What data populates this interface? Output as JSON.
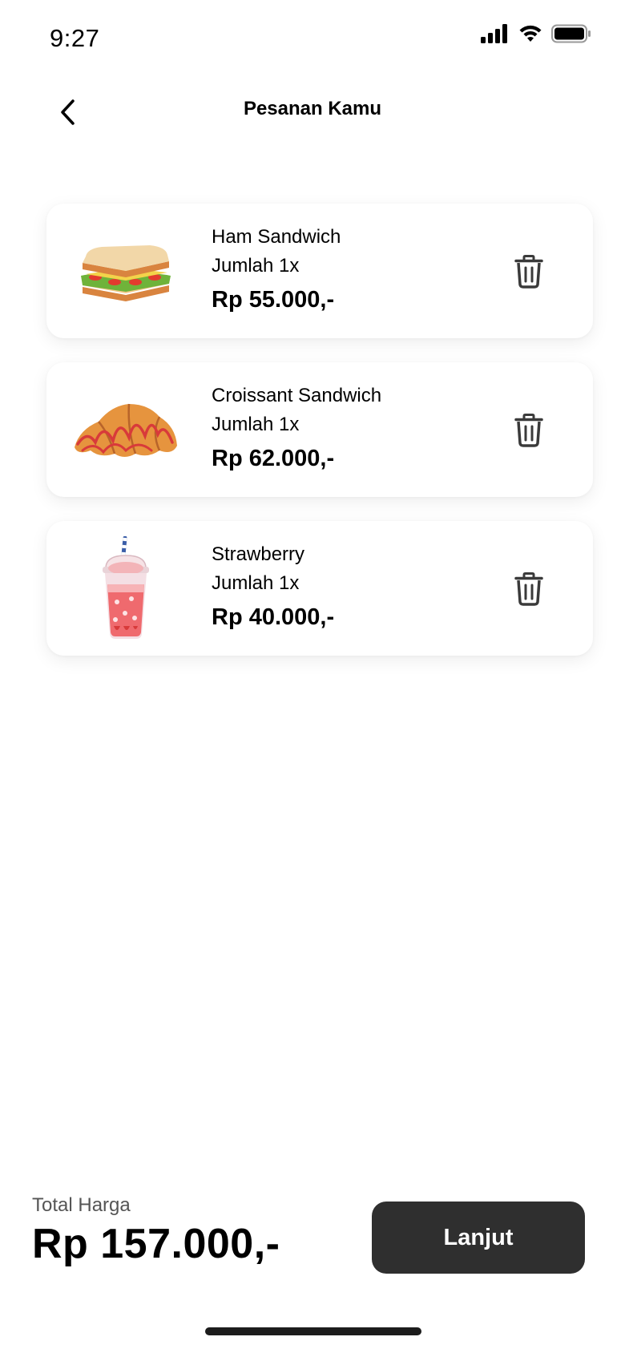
{
  "status_bar": {
    "time": "9:27",
    "icons": [
      "signal-icon",
      "wifi-icon",
      "battery-icon"
    ]
  },
  "header": {
    "back_icon": "chevron-left-icon",
    "title": "Pesanan Kamu"
  },
  "orders": [
    {
      "name": "Ham Sandwich",
      "quantity": "Jumlah 1x",
      "price": "Rp 55.000,-",
      "image": "ham-sandwich-image"
    },
    {
      "name": "Croissant Sandwich",
      "quantity": "Jumlah 1x",
      "price": "Rp 62.000,-",
      "image": "croissant-image"
    },
    {
      "name": "Strawberry",
      "quantity": "Jumlah 1x",
      "price": "Rp 40.000,-",
      "image": "strawberry-drink-image"
    }
  ],
  "footer": {
    "total_label": "Total Harga",
    "total_value": "Rp 157.000,-",
    "continue_label": "Lanjut"
  },
  "colors": {
    "background": "#ffffff",
    "button_bg": "#2f2f2f",
    "button_text": "#ffffff",
    "icon": "#3a3a3a"
  }
}
